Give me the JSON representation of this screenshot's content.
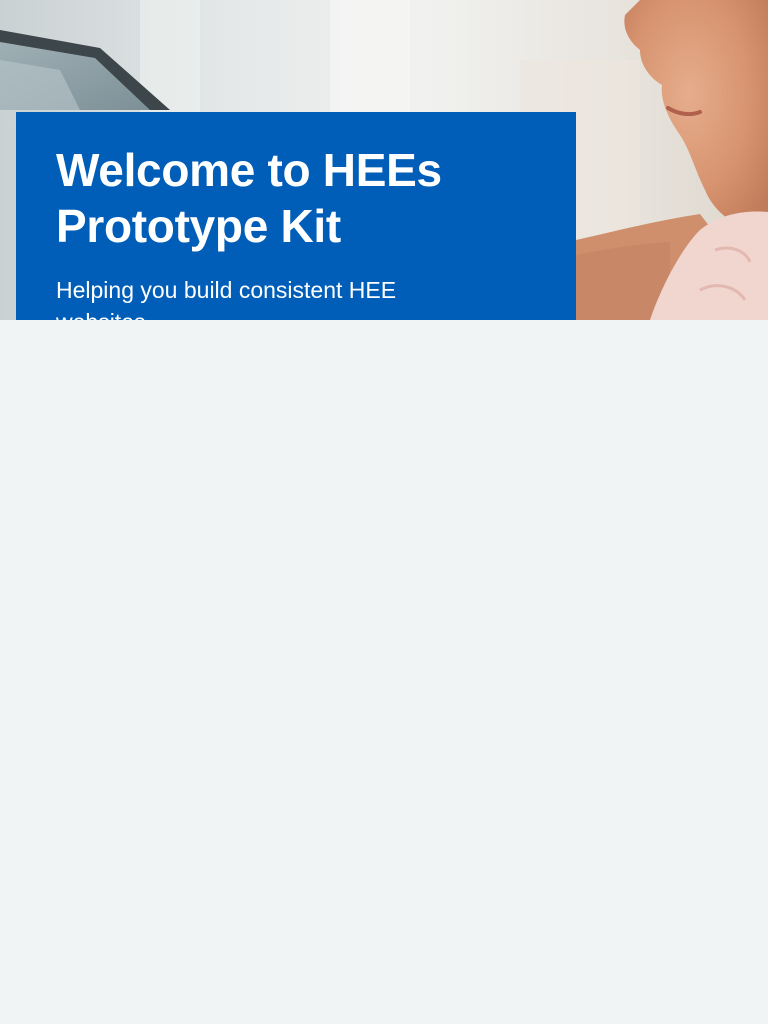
{
  "hero": {
    "image_description": "child using a tablet",
    "title": "Welcome to HEEs Prototype Kit",
    "subtitle": "Helping you build consistent HEE websites."
  },
  "colors": {
    "brand_blue": "#005eb8",
    "page_background": "#f0f4f5",
    "text_on_brand": "#ffffff"
  }
}
